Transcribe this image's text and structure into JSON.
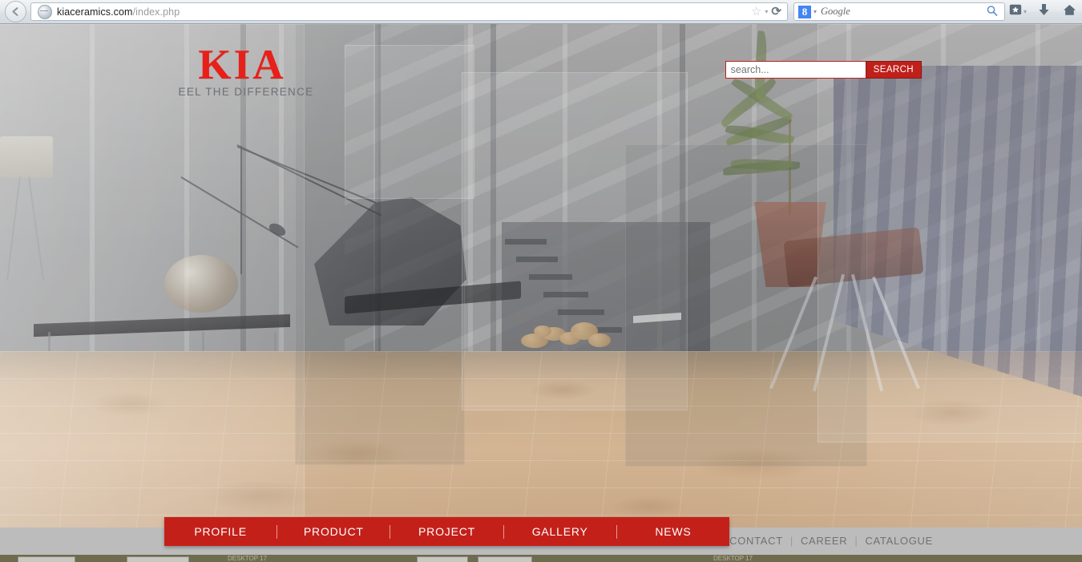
{
  "browser": {
    "back_label": "◀",
    "url_bold": "kiaceramics.com",
    "url_dim": "/index.php",
    "bookmark_star": "☆",
    "dropdown_caret": "▾",
    "reload": "⟳",
    "search_engine": "Google",
    "g_letter": "8",
    "magnifier": "⚲",
    "bookmarks_star": "★",
    "download_arrow": "⬇",
    "home": "⌂"
  },
  "site": {
    "logo_text": "KIA",
    "logo_tagline": "EEL THE DIFFERENCE",
    "search": {
      "value": "",
      "placeholder": "search...",
      "button_label": "SEARCH"
    },
    "nav": [
      {
        "label": "PROFILE"
      },
      {
        "label": "PRODUCT"
      },
      {
        "label": "PROJECT"
      },
      {
        "label": "GALLERY"
      },
      {
        "label": "NEWS"
      }
    ],
    "footer_links": [
      {
        "label": "CONTACT"
      },
      {
        "label": "CAREER"
      },
      {
        "label": "CATALOGUE"
      }
    ],
    "separator": "|",
    "colors": {
      "brand_red": "#c4201a",
      "logo_red": "#e8201a",
      "footer_gray": "#bcbcbc",
      "footer_text": "#6f7174"
    }
  },
  "taskbar": {
    "label_1": "DESKTOP 17",
    "label_2": "DESKTOP 17"
  }
}
